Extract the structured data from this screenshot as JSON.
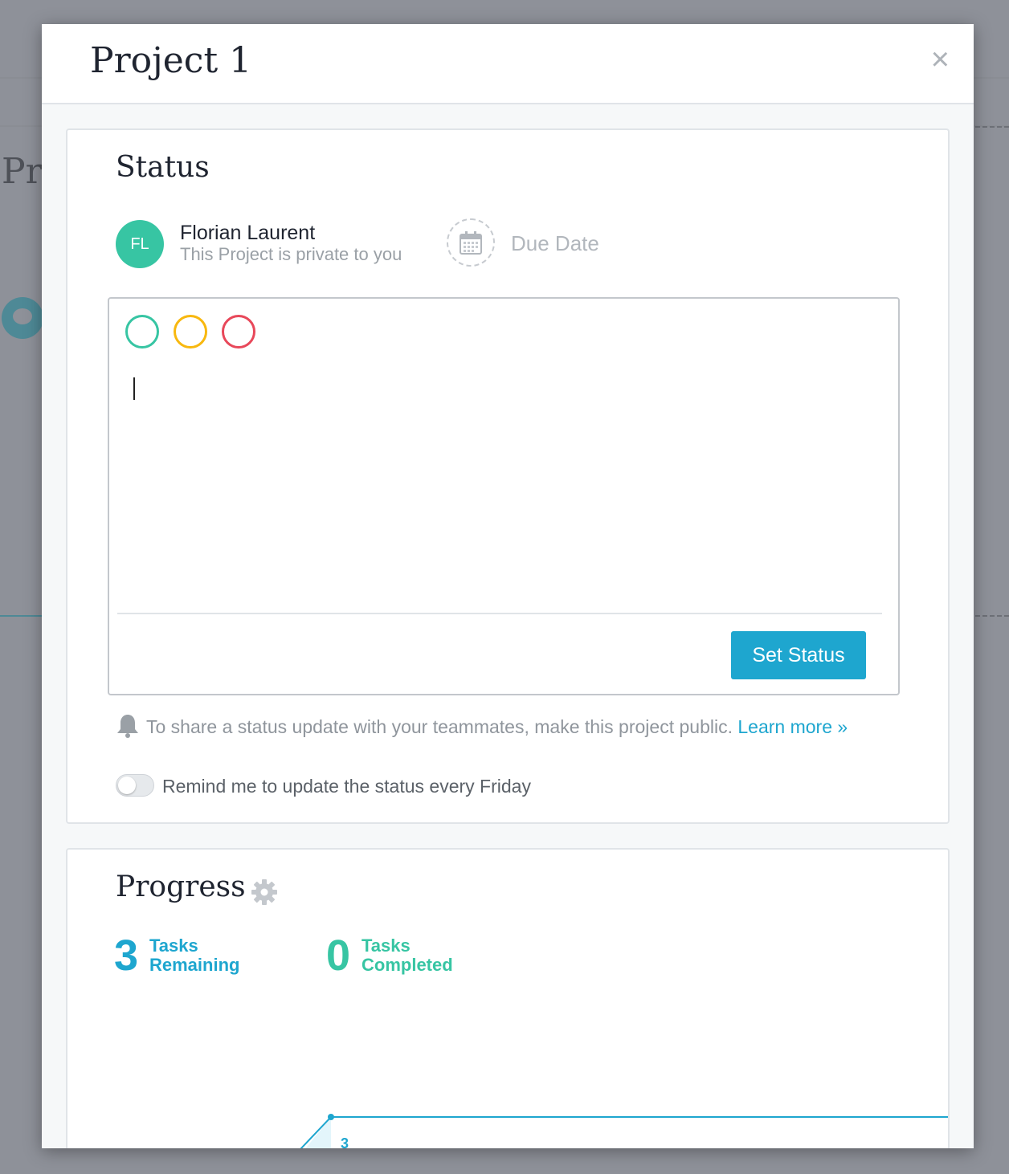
{
  "background": {
    "page_title_fragment": "Pr"
  },
  "modal": {
    "title": "Project 1",
    "close_label": "×"
  },
  "status": {
    "heading": "Status",
    "owner": {
      "initials": "FL",
      "name": "Florian Laurent",
      "subtitle": "This Project is private to you"
    },
    "due_date_label": "Due Date",
    "status_colors": [
      "#37c5a3",
      "#f8b80f",
      "#e8485a"
    ],
    "set_status_label": "Set Status",
    "share_note": "To share a status update with your teammates, make this project public.",
    "learn_more_label": "Learn more »",
    "remind_label": "Remind me to update the status every Friday",
    "remind_enabled": false
  },
  "progress": {
    "heading": "Progress",
    "remaining": {
      "count": "3",
      "label_line1": "Tasks",
      "label_line2": "Remaining"
    },
    "completed": {
      "count": "0",
      "label_line1": "Tasks",
      "label_line2": "Completed"
    },
    "chart_point_label": "3"
  },
  "colors": {
    "accent_blue": "#1ea6cf",
    "accent_green": "#37c5a3",
    "brand_avatar": "#37c5a3"
  }
}
